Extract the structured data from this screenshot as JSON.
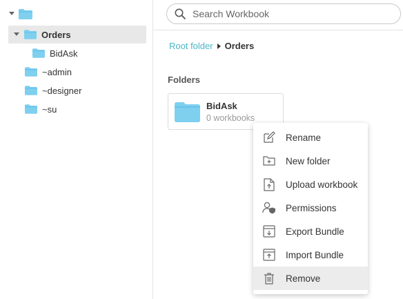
{
  "colors": {
    "folder": "#7fcfef",
    "folder_tab": "#5bbfe6",
    "link": "#4bb6c9",
    "selected_row": "#e8e8e8",
    "menu_hover": "#ececec"
  },
  "sidebar": {
    "root": {
      "icon": "folder-icon",
      "expanded": true
    },
    "items": [
      {
        "label": "Orders",
        "icon": "folder-icon",
        "expanded": true,
        "selected": true
      },
      {
        "label": "BidAsk",
        "icon": "folder-icon"
      },
      {
        "label": "~admin",
        "icon": "folder-icon"
      },
      {
        "label": "~designer",
        "icon": "folder-icon"
      },
      {
        "label": "~su",
        "icon": "folder-icon"
      }
    ]
  },
  "search": {
    "placeholder": "Search Workbook",
    "value": "",
    "icon": "search-icon"
  },
  "breadcrumb": {
    "root": "Root folder",
    "current": "Orders"
  },
  "folders_section": {
    "title": "Folders",
    "cards": [
      {
        "name": "BidAsk",
        "count": "0 workbooks",
        "icon": "folder-icon"
      }
    ]
  },
  "context_menu": {
    "items": [
      {
        "label": "Rename",
        "icon": "rename-icon"
      },
      {
        "label": "New folder",
        "icon": "new-folder-icon"
      },
      {
        "label": "Upload workbook",
        "icon": "upload-workbook-icon"
      },
      {
        "label": "Permissions",
        "icon": "permissions-icon"
      },
      {
        "label": "Export Bundle",
        "icon": "export-bundle-icon"
      },
      {
        "label": "Import Bundle",
        "icon": "import-bundle-icon"
      },
      {
        "label": "Remove",
        "icon": "trash-icon",
        "hovered": true
      }
    ]
  }
}
